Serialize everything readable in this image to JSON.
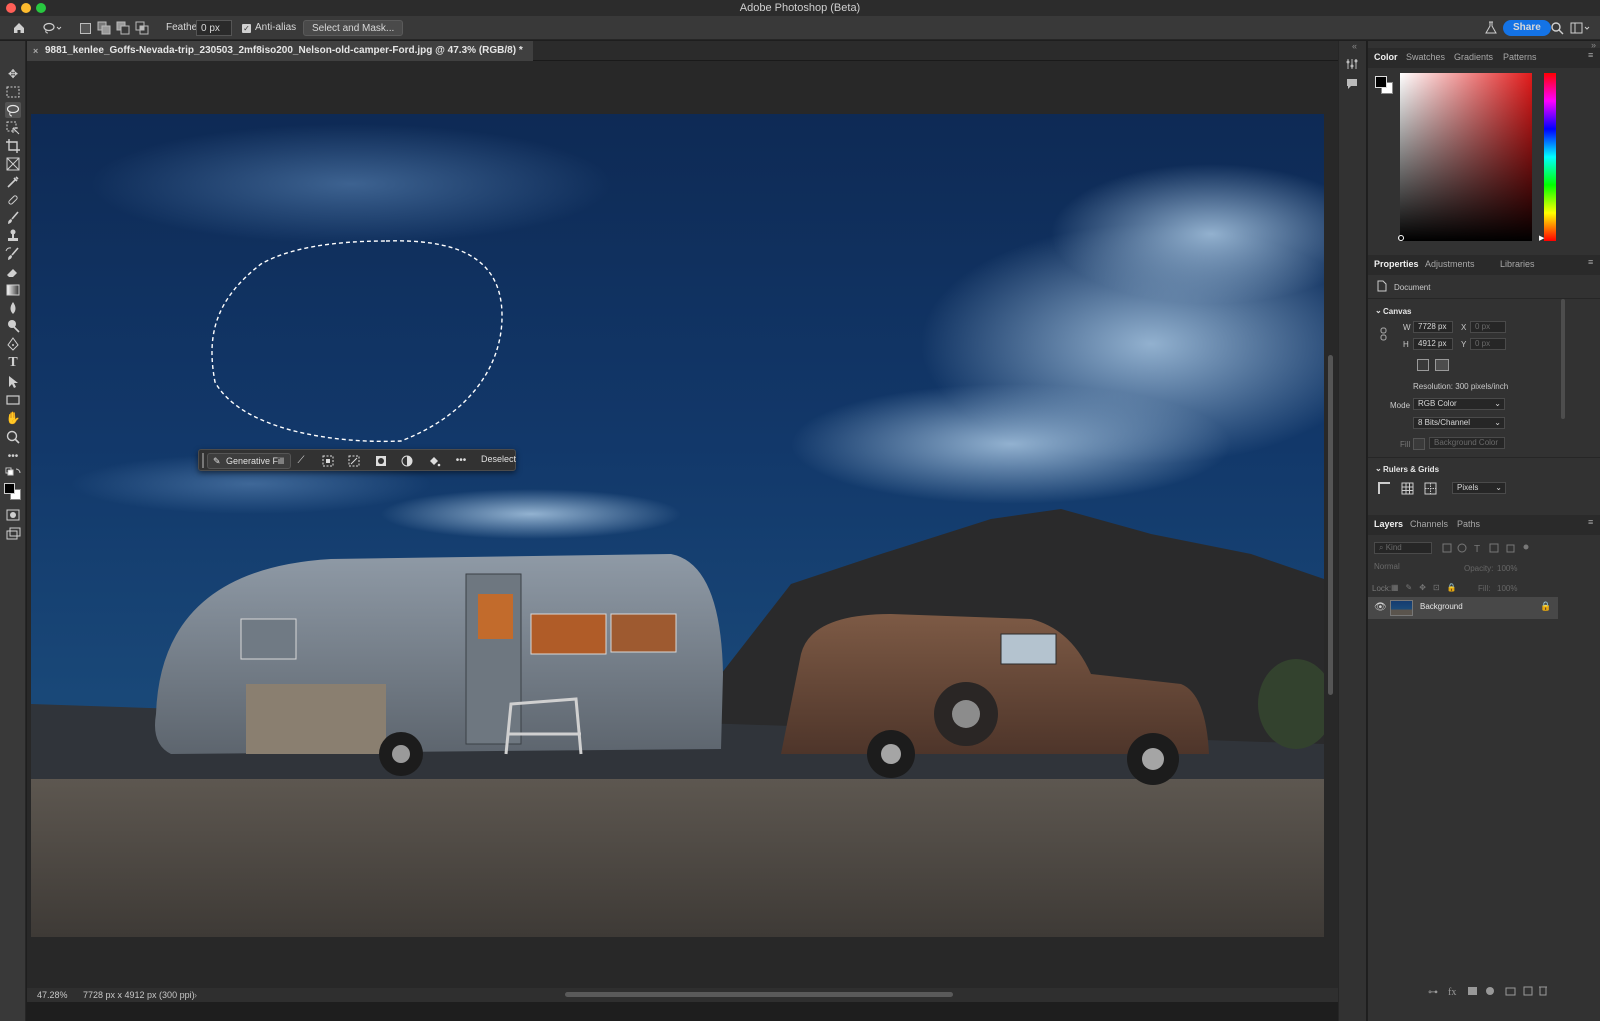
{
  "window": {
    "title": "Adobe Photoshop (Beta)"
  },
  "options_bar": {
    "feather_label": "Feather:",
    "feather_value": "0 px",
    "anti_alias_label": "Anti-alias",
    "select_and_mask_label": "Select and Mask...",
    "share_label": "Share"
  },
  "document": {
    "tab_title": "9881_kenlee_Goffs-Nevada-trip_230503_2mf8iso200_Nelson-old-camper-Ford.jpg @ 47.3% (RGB/8) *"
  },
  "contextual_taskbar": {
    "generative_fill_label": "Generative Fill",
    "deselect_label": "Deselect"
  },
  "status_bar": {
    "zoom": "47.28%",
    "doc_info": "7728 px x 4912 px (300 ppi)"
  },
  "color_panel": {
    "tabs": [
      "Color",
      "Swatches",
      "Gradients",
      "Patterns"
    ],
    "active_tab": "Color",
    "hue_color": "#e21b1b"
  },
  "properties_panel": {
    "tabs": [
      "Properties",
      "Adjustments",
      "Libraries"
    ],
    "active_tab": "Properties",
    "document_label": "Document",
    "canvas_section": "Canvas",
    "width_label": "W",
    "width_value": "7728 px",
    "height_label": "H",
    "height_value": "4912 px",
    "x_label": "X",
    "x_value": "0 px",
    "y_label": "Y",
    "y_value": "0 px",
    "resolution_text": "Resolution: 300 pixels/inch",
    "mode_label": "Mode",
    "mode_value": "RGB Color",
    "bits_value": "8 Bits/Channel",
    "fill_label": "Fill",
    "fill_value": "Background Color",
    "rulers_section": "Rulers & Grids",
    "units_value": "Pixels"
  },
  "layers_panel": {
    "tabs": [
      "Layers",
      "Channels",
      "Paths"
    ],
    "active_tab": "Layers",
    "kind_placeholder": "Kind",
    "blend_mode": "Normal",
    "opacity_label": "Opacity:",
    "opacity_value": "100%",
    "lock_label": "Lock:",
    "fill_label": "Fill:",
    "fill_value": "100%",
    "layers": [
      {
        "name": "Background",
        "visible": true,
        "locked": true
      }
    ]
  }
}
